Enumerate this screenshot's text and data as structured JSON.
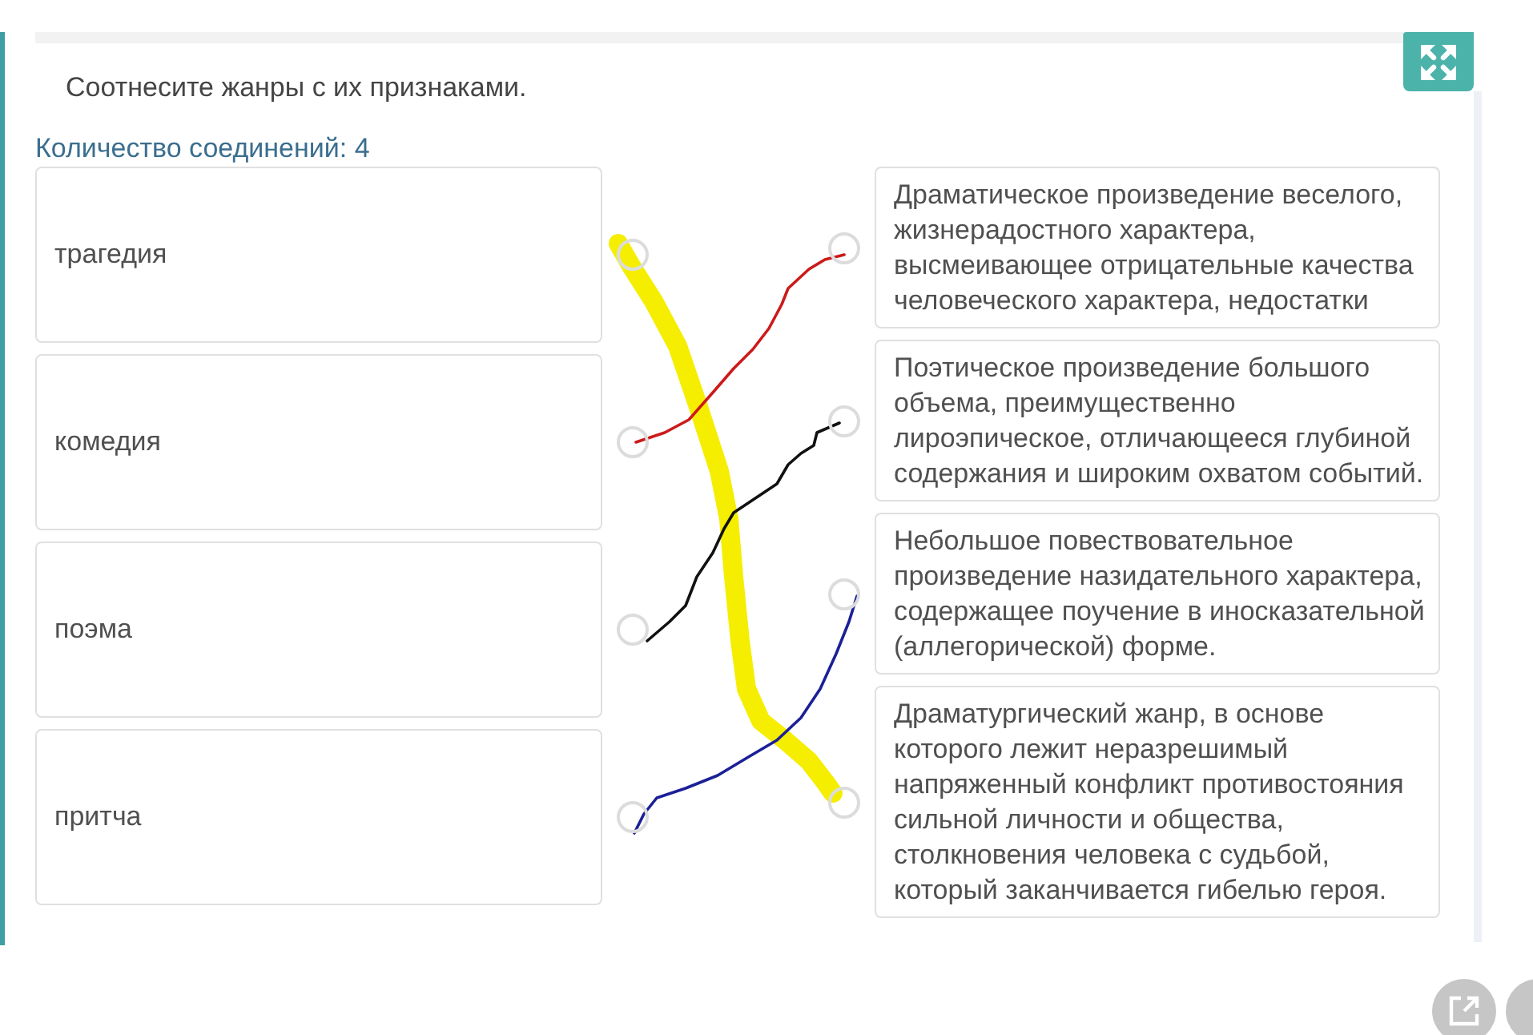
{
  "title": "Соотнесите жанры с их признаками.",
  "connection_count": "Количество соединений: 4",
  "genres": [
    "трагедия",
    "комедия",
    "поэма",
    "притча"
  ],
  "descriptions": [
    "Драматическое произведение веселого, жизнерадостного характера, высмеивающее отрицательные качества человеческого характера, недостатки",
    "Поэтическое произведение большого объема, преимущественно лироэпическое, отличающееся глубиной содержания и широким охватом событий.",
    "Небольшое повествовательное произведение назидательного характера, содержащее поучение в иносказательной (аллегорической) форме.",
    "Драматургический жанр, в основе которого лежит неразрешимый напряженный конфликт противостояния сильной личности и общества, столкновения человека с судьбой, который заканчивается гибелью героя."
  ],
  "drawn_lines": [
    {
      "kind": "highlighter",
      "color": "#f5ee00"
    },
    {
      "kind": "pen",
      "color": "#cc1a1a"
    },
    {
      "kind": "pen",
      "color": "#111111"
    },
    {
      "kind": "pen",
      "color": "#1c2096"
    }
  ]
}
